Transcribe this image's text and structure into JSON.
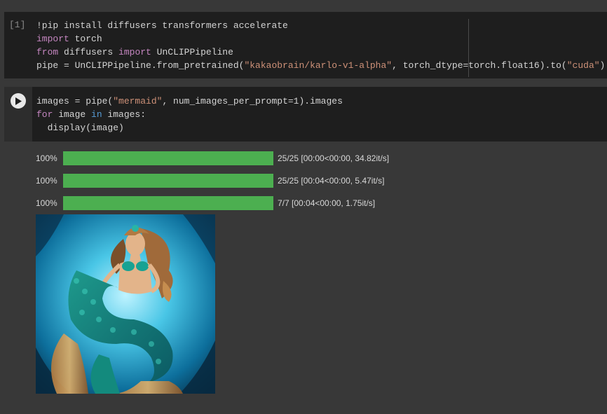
{
  "cell1": {
    "execution_count": "[1]",
    "lines": [
      [
        {
          "t": "!pip install diffusers transformers accelerate",
          "c": ""
        }
      ],
      [
        {
          "t": "import",
          "c": "kw"
        },
        {
          "t": " torch",
          "c": ""
        }
      ],
      [
        {
          "t": "from",
          "c": "kw"
        },
        {
          "t": " diffusers ",
          "c": ""
        },
        {
          "t": "import",
          "c": "kw"
        },
        {
          "t": " UnCLIPPipeline",
          "c": ""
        }
      ],
      [
        {
          "t": "pipe = UnCLIPPipeline.from_pretrained(",
          "c": ""
        },
        {
          "t": "\"kakaobrain/karlo-v1-alpha\"",
          "c": "str"
        },
        {
          "t": ", torch_dtype=torch.float16).to(",
          "c": ""
        },
        {
          "t": "\"cuda\"",
          "c": "str"
        },
        {
          "t": ")",
          "c": ""
        }
      ]
    ]
  },
  "cell2": {
    "run_icon": "play-icon",
    "lines": [
      [
        {
          "t": "images = pipe(",
          "c": ""
        },
        {
          "t": "\"mermaid\"",
          "c": "str"
        },
        {
          "t": ", num_images_per_prompt=1).images",
          "c": ""
        }
      ],
      [
        {
          "t": "for",
          "c": "kw"
        },
        {
          "t": " image ",
          "c": ""
        },
        {
          "t": "in",
          "c": "kwb"
        },
        {
          "t": " images:",
          "c": ""
        }
      ],
      [
        {
          "t": "  display(image)",
          "c": ""
        }
      ]
    ],
    "progress": [
      {
        "percent_label": "100%",
        "fraction": 1.0,
        "info": "25/25 [00:00<00:00, 34.82it/s]"
      },
      {
        "percent_label": "100%",
        "fraction": 1.0,
        "info": "25/25 [00:04<00:00, 5.47it/s]"
      },
      {
        "percent_label": "100%",
        "fraction": 1.0,
        "info": "7/7 [00:04<00:00, 1.75it/s]"
      }
    ],
    "image_subject": "mermaid"
  },
  "colors": {
    "progress_fill": "#4caf50",
    "keyword": "#c586c0",
    "string": "#ce9178"
  }
}
